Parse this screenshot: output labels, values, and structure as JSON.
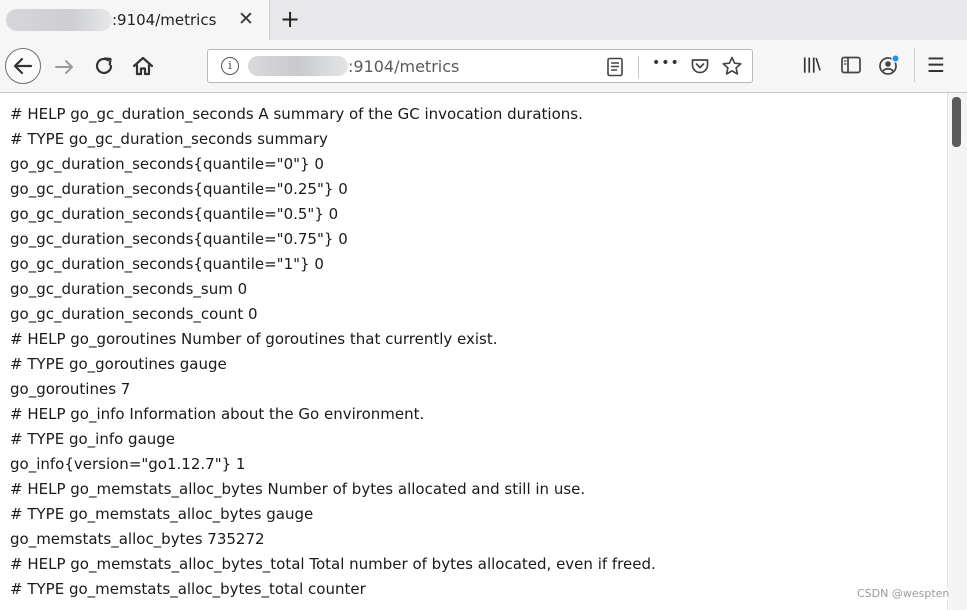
{
  "tab": {
    "title": ":9104/metrics",
    "close_glyph": "✕",
    "new_tab_glyph": "+"
  },
  "navigation": {
    "back_icon": "back-arrow-icon",
    "forward_icon": "forward-arrow-icon",
    "reload_icon": "reload-icon",
    "home_icon": "home-icon"
  },
  "urlbar": {
    "info_glyph": "i",
    "url_text": ":9104/metrics",
    "reader_icon": "reader-view-icon",
    "more_glyph": "•••",
    "pocket_icon": "pocket-icon",
    "bookmark_icon": "star-icon"
  },
  "toolbar": {
    "library_glyph": "|||\\",
    "sidebar_icon": "sidebar-icon",
    "account_icon": "account-icon",
    "menu_glyph": "☰"
  },
  "content": {
    "lines": [
      "# HELP go_gc_duration_seconds A summary of the GC invocation durations.",
      "# TYPE go_gc_duration_seconds summary",
      "go_gc_duration_seconds{quantile=\"0\"} 0",
      "go_gc_duration_seconds{quantile=\"0.25\"} 0",
      "go_gc_duration_seconds{quantile=\"0.5\"} 0",
      "go_gc_duration_seconds{quantile=\"0.75\"} 0",
      "go_gc_duration_seconds{quantile=\"1\"} 0",
      "go_gc_duration_seconds_sum 0",
      "go_gc_duration_seconds_count 0",
      "# HELP go_goroutines Number of goroutines that currently exist.",
      "# TYPE go_goroutines gauge",
      "go_goroutines 7",
      "# HELP go_info Information about the Go environment.",
      "# TYPE go_info gauge",
      "go_info{version=\"go1.12.7\"} 1",
      "# HELP go_memstats_alloc_bytes Number of bytes allocated and still in use.",
      "# TYPE go_memstats_alloc_bytes gauge",
      "go_memstats_alloc_bytes 735272",
      "# HELP go_memstats_alloc_bytes_total Total number of bytes allocated, even if freed.",
      "# TYPE go_memstats_alloc_bytes_total counter"
    ]
  },
  "watermark": "CSDN @wespten"
}
